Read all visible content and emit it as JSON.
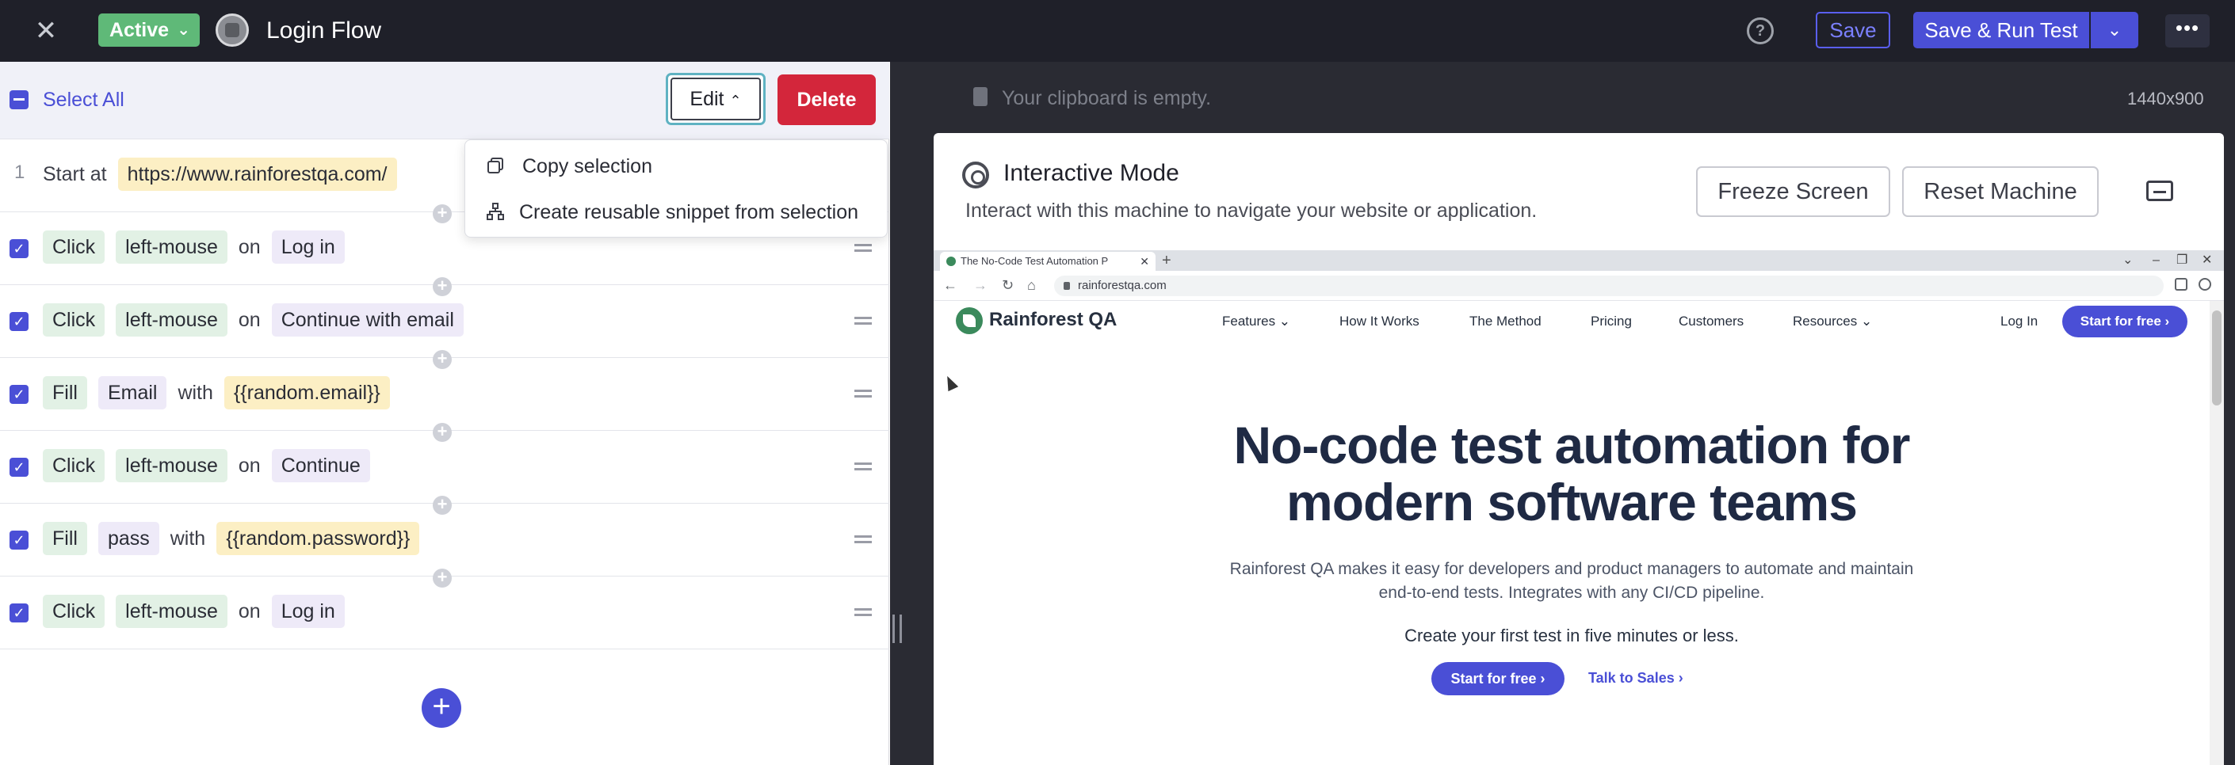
{
  "topbar": {
    "close_icon": "close-icon",
    "status": "Active",
    "title": "Login Flow",
    "help_icon": "help-icon",
    "save_label": "Save",
    "save_run_label": "Save & Run Test"
  },
  "toolbar": {
    "select_all": "Select All",
    "edit": "Edit",
    "delete": "Delete"
  },
  "menu": {
    "items": [
      {
        "label": "Copy selection",
        "icon": "copy-icon"
      },
      {
        "label": "Create reusable snippet from selection",
        "icon": "snippet-icon"
      }
    ]
  },
  "steps": [
    {
      "num": "1",
      "action": "Start at",
      "url": "https://www.rainforestqa.com/"
    },
    {
      "action": "Click",
      "target": "left-mouse",
      "conj": "on",
      "value": "Log in"
    },
    {
      "action": "Click",
      "target": "left-mouse",
      "conj": "on",
      "value": "Continue with email"
    },
    {
      "action": "Fill",
      "target": "Email",
      "conj": "with",
      "value": "{{random.email}}"
    },
    {
      "action": "Click",
      "target": "left-mouse",
      "conj": "on",
      "value": "Continue"
    },
    {
      "action": "Fill",
      "target": "pass",
      "conj": "with",
      "value": "{{random.password}}"
    },
    {
      "action": "Click",
      "target": "left-mouse",
      "conj": "on",
      "value": "Log in"
    }
  ],
  "right": {
    "clipboard": "Your clipboard is empty.",
    "resolution": "1440x900",
    "interactive_title": "Interactive Mode",
    "interactive_sub": "Interact with this machine to navigate your website or application.",
    "freeze": "Freeze Screen",
    "reset": "Reset Machine"
  },
  "browser": {
    "tab_title": "The No-Code Test Automation P",
    "url": "rainforestqa.com"
  },
  "site": {
    "logo": "Rainforest QA",
    "nav": [
      "Features ⌄",
      "How It Works",
      "The Method",
      "Pricing",
      "Customers",
      "Resources ⌄"
    ],
    "login": "Log In",
    "cta": "Start for free ›",
    "hero_line1": "No-code test automation for",
    "hero_line2": "modern software teams",
    "sub_line1": "Rainforest QA makes it easy for developers and product managers to automate and maintain",
    "sub_line2": "end-to-end tests. Integrates with any CI/CD pipeline.",
    "sub2": "Create your first test in five minutes or less.",
    "hero_cta": "Start for free ›",
    "sales": "Talk to Sales ›"
  },
  "colors": {
    "accent": "#4a4fd6",
    "active_green": "#5fb978",
    "delete_red": "#d3263b",
    "topbar_bg": "#1f2029"
  }
}
